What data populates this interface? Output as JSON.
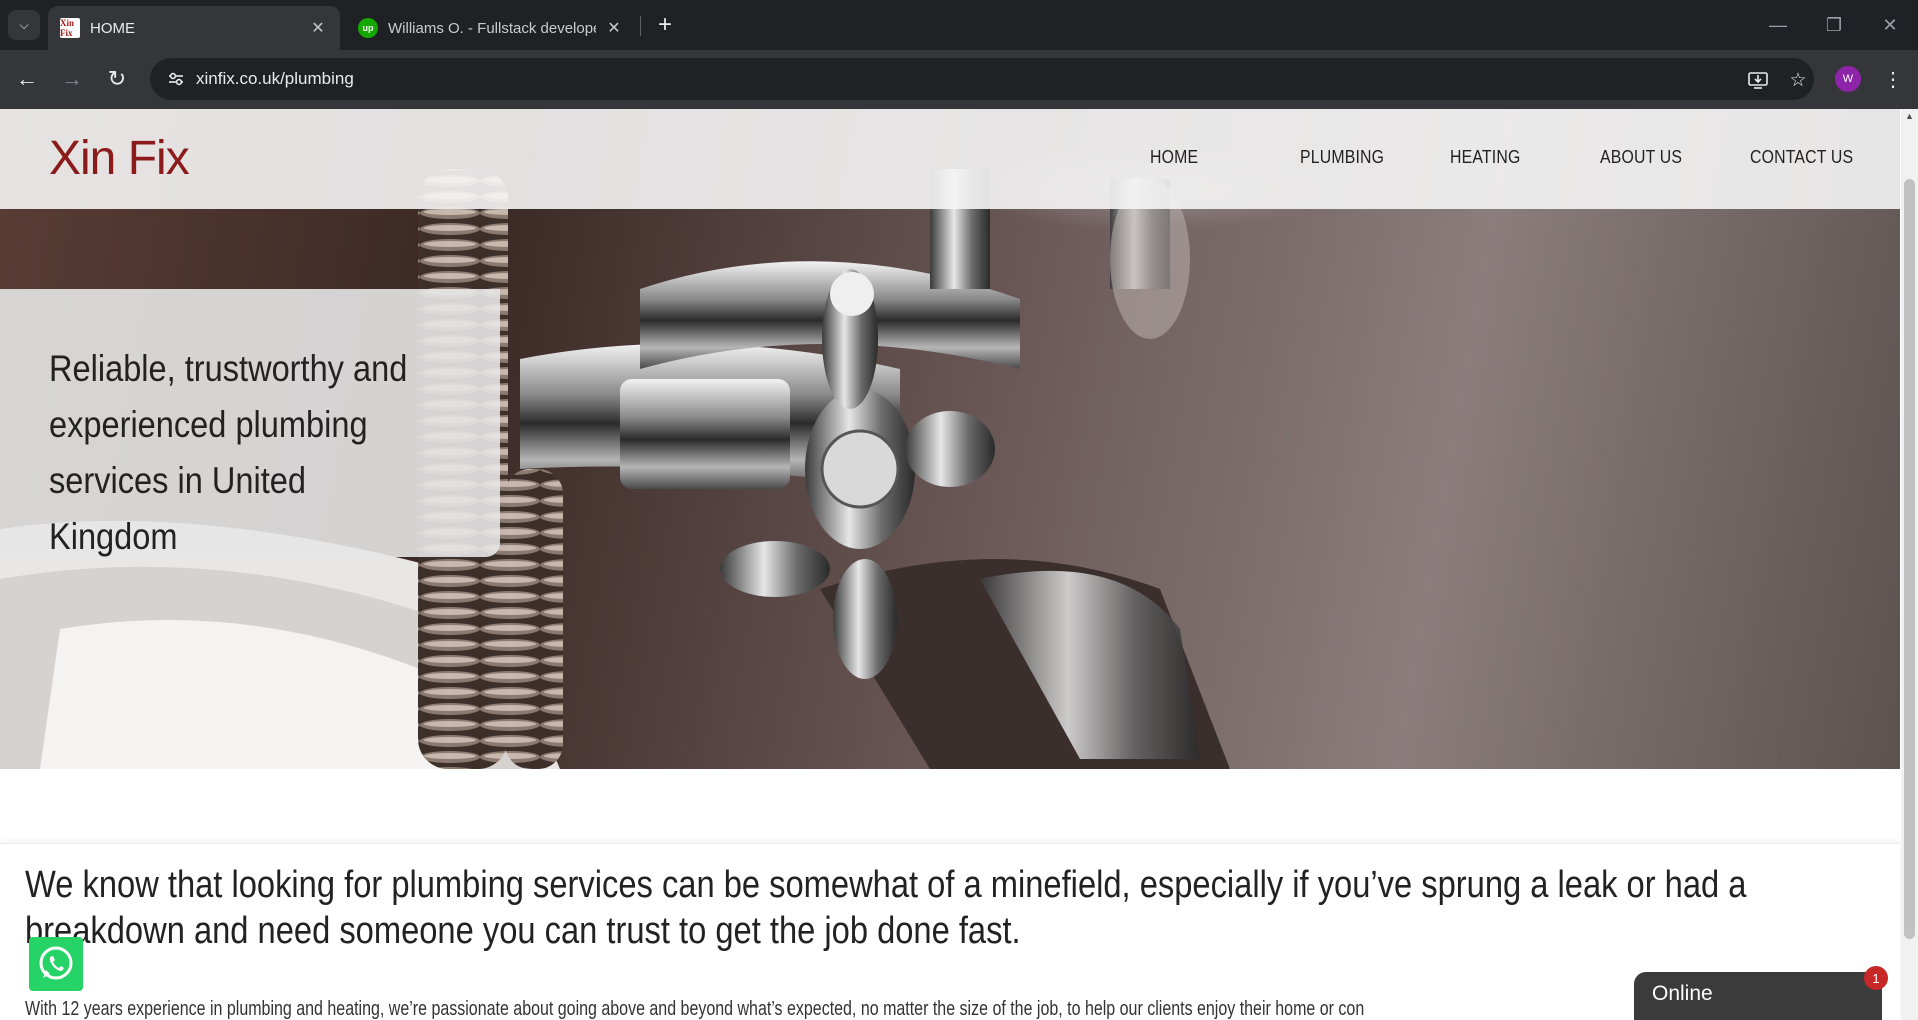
{
  "browser": {
    "tabs": [
      {
        "title": "HOME",
        "favicon": "xin-fix-favicon",
        "active": true
      },
      {
        "title": "Williams O. - Fullstack developer",
        "favicon": "upwork-favicon",
        "active": false
      }
    ],
    "favicon_text": {
      "xin": "Xin Fix",
      "up": "up"
    },
    "url": "xinfix.co.uk/plumbing",
    "profile_initial": "W",
    "icons": {
      "tab_search": "chevron-down-icon",
      "close": "close-icon",
      "new_tab": "plus-icon",
      "back": "back-arrow-icon",
      "forward": "forward-arrow-icon",
      "reload": "reload-icon",
      "site_info": "tune-icon",
      "install": "install-app-icon",
      "bookmark": "star-icon",
      "menu": "kebab-menu-icon"
    }
  },
  "site": {
    "logo": "Xin Fix",
    "brand_color": "#8b1a1a",
    "nav": [
      "HOME",
      "PLUMBING",
      "HEATING",
      "ABOUT US",
      "CONTACT US"
    ],
    "hero_text": "Reliable, trustworthy and experienced plumbing services in United Kingdom",
    "lead": "We know that looking for plumbing services can be somewhat of a minefield, especially if you’ve sprung a leak or had a breakdown and need someone you can trust to get the job done fast.",
    "paragraph": "With 12 years experience in plumbing and heating, we’re passionate about going above and beyond what’s expected, no matter the size of the job, to help our clients enjoy their home or con"
  },
  "widgets": {
    "whatsapp_icon": "whatsapp-icon",
    "chat_label": "Online",
    "chat_badge": "1"
  }
}
